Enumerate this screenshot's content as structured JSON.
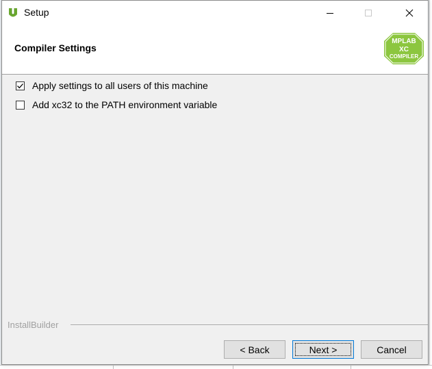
{
  "window": {
    "title": "Setup",
    "minimize_icon": "minimize-icon",
    "maximize_icon": "maximize-icon",
    "close_icon": "close-icon"
  },
  "header": {
    "title": "Compiler Settings",
    "logo": {
      "line1": "MPLAB",
      "line2": "XC",
      "line3": "COMPILER",
      "color": "#8cc63f"
    }
  },
  "options": [
    {
      "label": "Apply settings to all users of this machine",
      "checked": true
    },
    {
      "label": "Add xc32 to the PATH environment variable",
      "checked": false
    }
  ],
  "footer": {
    "group_label": "InstallBuilder",
    "back_label": "< Back",
    "next_label": "Next >",
    "cancel_label": "Cancel"
  },
  "colors": {
    "accent": "#0078d7",
    "brand_green": "#8cc63f"
  }
}
